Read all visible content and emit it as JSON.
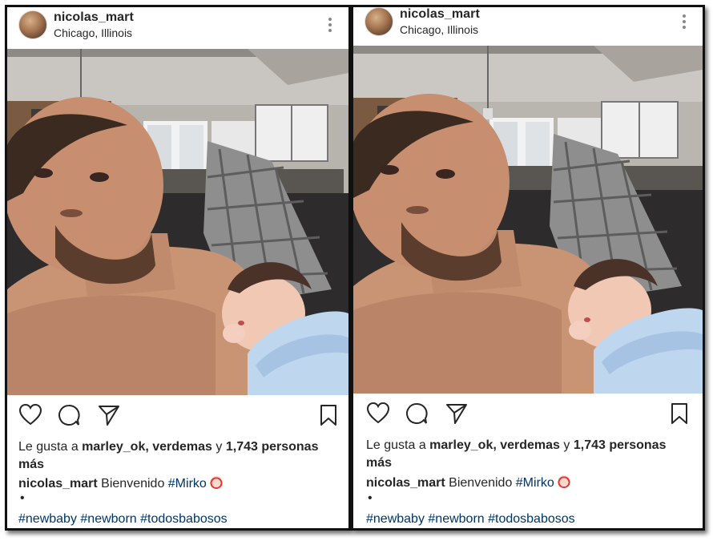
{
  "posts": [
    {
      "username": "nicolas_mart",
      "location": "Chicago, Illinois",
      "likes_prefix": "Le gusta a ",
      "liked_by": "marley_ok, verdemas",
      "likes_connector": " y ",
      "likes_count": "1,743 personas",
      "likes_suffix": "más",
      "caption_user": "nicolas_mart",
      "caption_text": " Bienvenido ",
      "caption_tag": "#Mirko",
      "bullet": "•",
      "hashtags": "#newbaby #newborn #todosbabosos"
    },
    {
      "username": "nicolas_mart",
      "location": "Chicago, Illinois",
      "likes_prefix": "Le gusta a ",
      "liked_by": "marley_ok, verdemas",
      "likes_connector": " y ",
      "likes_count": "1,743 personas",
      "likes_suffix": "más",
      "caption_user": "nicolas_mart",
      "caption_text": " Bienvenido ",
      "caption_tag": "#Mirko",
      "bullet": "•",
      "hashtags": "#newbaby #newborn #todosbabosos"
    }
  ],
  "icons": {
    "more": "more-options-icon",
    "like": "heart-icon",
    "comment": "comment-icon",
    "share": "send-icon",
    "save": "bookmark-icon",
    "caption_emoji": "baby-emoji-icon"
  },
  "colors": {
    "text": "#262626",
    "hashtag": "#003569",
    "border": "#111111"
  }
}
